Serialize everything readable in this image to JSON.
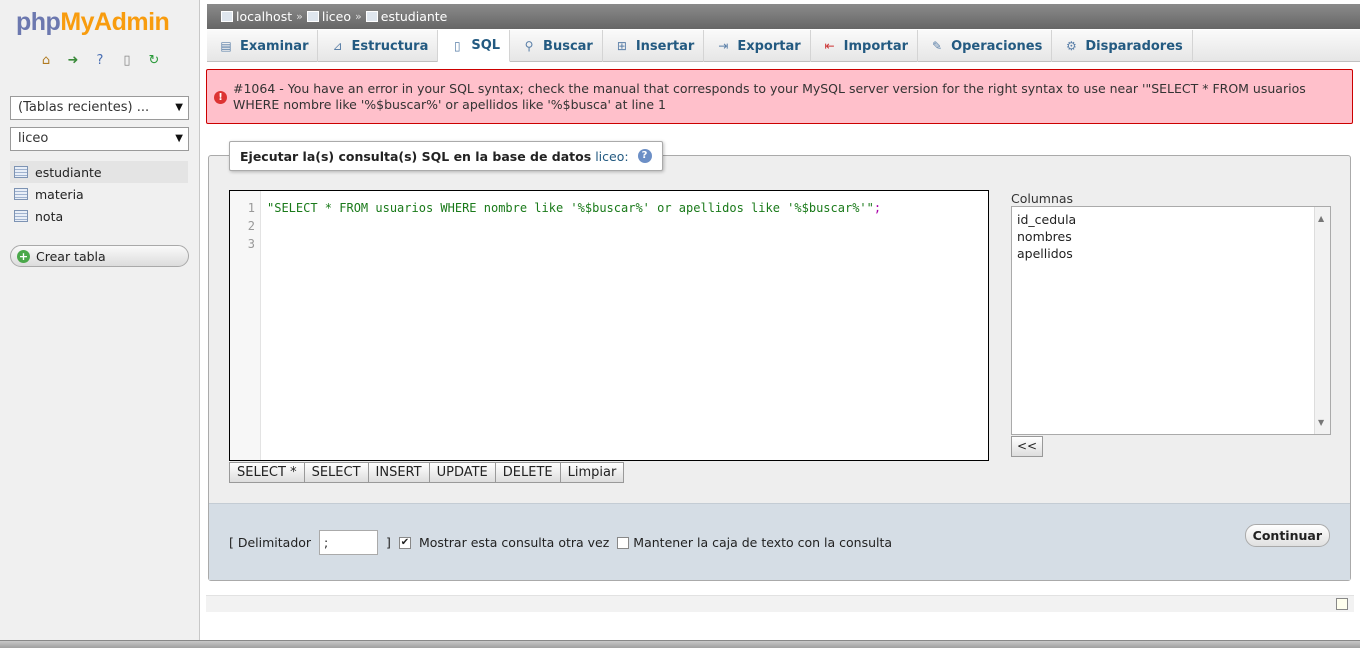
{
  "sidebar": {
    "logo_part1": "php",
    "logo_part2": "MyAdmin",
    "recent_tables": "(Tablas recientes) ...",
    "database": "liceo",
    "tables": [
      "estudiante",
      "materia",
      "nota"
    ],
    "create_table": "Crear tabla"
  },
  "breadcrumb": {
    "server": "localhost",
    "database": "liceo",
    "table": "estudiante",
    "separator": "»"
  },
  "tabs": [
    {
      "label": "Examinar",
      "icon": "browse-icon"
    },
    {
      "label": "Estructura",
      "icon": "structure-icon"
    },
    {
      "label": "SQL",
      "icon": "sql-icon"
    },
    {
      "label": "Buscar",
      "icon": "search-icon"
    },
    {
      "label": "Insertar",
      "icon": "insert-icon"
    },
    {
      "label": "Exportar",
      "icon": "export-icon"
    },
    {
      "label": "Importar",
      "icon": "import-icon"
    },
    {
      "label": "Operaciones",
      "icon": "wrench-icon"
    },
    {
      "label": "Disparadores",
      "icon": "triggers-icon"
    }
  ],
  "active_tab": "SQL",
  "error": {
    "message": "#1064 - You have an error in your SQL syntax; check the manual that corresponds to your MySQL server version for the right syntax to use near '\"SELECT * FROM usuarios WHERE nombre like '%$buscar%' or apellidos like '%$busca' at line 1"
  },
  "query_box": {
    "legend": "Ejecutar la(s) consulta(s) SQL en la base de datos",
    "legend_db": "liceo:",
    "line_numbers": [
      "1",
      "2",
      "3"
    ],
    "code_string": "\"SELECT * FROM usuarios WHERE nombre like '%$buscar%' or apellidos like '%$buscar%'\"",
    "code_semicolon": ";",
    "buttons": [
      "SELECT *",
      "SELECT",
      "INSERT",
      "UPDATE",
      "DELETE",
      "Limpiar"
    ]
  },
  "columns": {
    "label": "Columnas",
    "items": [
      "id_cedula",
      "nombres",
      "apellidos"
    ],
    "insert_button": "<<"
  },
  "options": {
    "delimiter_label": "[ Delimitador",
    "delimiter_value": ";",
    "delimiter_close": "]",
    "show_query_label": "Mostrar esta consulta otra vez",
    "show_query_checked": true,
    "keep_box_label": "Mantener la caja de texto con la consulta",
    "keep_box_checked": false,
    "continue_label": "Continuar"
  }
}
